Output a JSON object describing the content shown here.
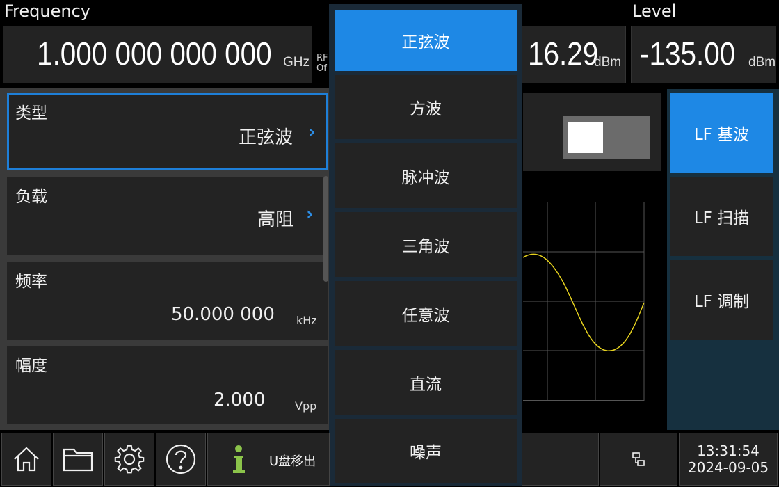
{
  "header": {
    "frequency_label": "Frequency",
    "frequency_value": "1.000 000 000 000",
    "frequency_unit": "GHz",
    "rf_line1": "RF",
    "rf_line2": "Of",
    "offset_value": "16.29",
    "offset_unit": "dBm",
    "level_label": "Level",
    "level_value": "-135.00",
    "level_unit": "dBm"
  },
  "params": [
    {
      "label": "类型",
      "value": "正弦波",
      "chevron": "›"
    },
    {
      "label": "负载",
      "value": "高阻",
      "chevron": "›"
    },
    {
      "label": "频率",
      "value": "50.000 000",
      "unit": "kHz"
    },
    {
      "label": "幅度",
      "value": "2.000",
      "unit": "Vpp"
    }
  ],
  "dropdown": {
    "items": [
      "正弦波",
      "方波",
      "脉冲波",
      "三角波",
      "任意波",
      "直流",
      "噪声"
    ],
    "selected_index": 0
  },
  "softkeys": [
    "LF 基波",
    "LF 扫描",
    "LF 调制"
  ],
  "softkey_active": 0,
  "statusbar": {
    "message": "U盘移出",
    "info_icon": "info-icon",
    "time": "13:31:54",
    "date": "2024-09-05"
  },
  "colors": {
    "accent": "#1e88e5",
    "chevron": "#2d8ee6",
    "info_icon": "#8bc34a",
    "waveform": "#e6d21e"
  }
}
